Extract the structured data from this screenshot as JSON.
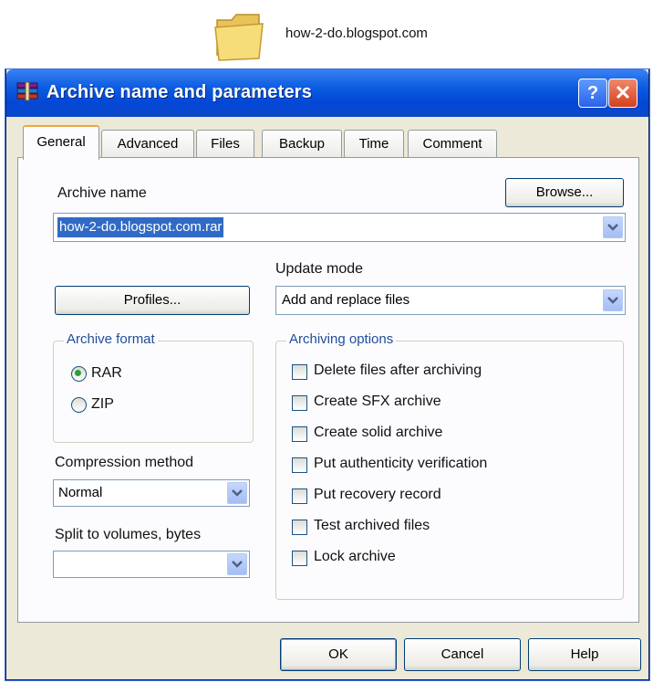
{
  "desktop": {
    "folder_caption": "how-2-do.blogspot.com"
  },
  "window": {
    "title": "Archive name and parameters",
    "help_label": "?",
    "close_label": "✕"
  },
  "tabs": [
    {
      "label": "General",
      "active": true
    },
    {
      "label": "Advanced",
      "active": false
    },
    {
      "label": "Files",
      "active": false
    },
    {
      "label": "Backup",
      "active": false
    },
    {
      "label": "Time",
      "active": false
    },
    {
      "label": "Comment",
      "active": false
    }
  ],
  "general": {
    "archive_name_label": "Archive name",
    "archive_name_value": "how-2-do.blogspot.com.rar",
    "browse_label": "Browse...",
    "update_mode_label": "Update mode",
    "update_mode_value": "Add and replace files",
    "profiles_label": "Profiles...",
    "archive_format": {
      "title": "Archive format",
      "options": [
        {
          "label": "RAR",
          "selected": true
        },
        {
          "label": "ZIP",
          "selected": false
        }
      ]
    },
    "compression_method_label": "Compression method",
    "compression_method_value": "Normal",
    "split_label": "Split to volumes, bytes",
    "split_value": "",
    "archiving_options": {
      "title": "Archiving options",
      "items": [
        {
          "label": "Delete files after archiving",
          "checked": false
        },
        {
          "label": "Create SFX archive",
          "checked": false
        },
        {
          "label": "Create solid archive",
          "checked": false
        },
        {
          "label": "Put authenticity verification",
          "checked": false
        },
        {
          "label": "Put recovery record",
          "checked": false
        },
        {
          "label": "Test archived files",
          "checked": false
        },
        {
          "label": "Lock archive",
          "checked": false
        }
      ]
    }
  },
  "footer": {
    "ok_label": "OK",
    "cancel_label": "Cancel",
    "help_label": "Help"
  },
  "colors": {
    "titlebar": "#0a5be0",
    "dialog_bg": "#ece9d8",
    "tab_accent": "#f2a53a",
    "group_title": "#1f4e9c",
    "selection": "#316ac5"
  },
  "icons": [
    "folder-icon",
    "winrar-books-icon",
    "help-icon",
    "close-icon",
    "chevron-down-icon"
  ]
}
